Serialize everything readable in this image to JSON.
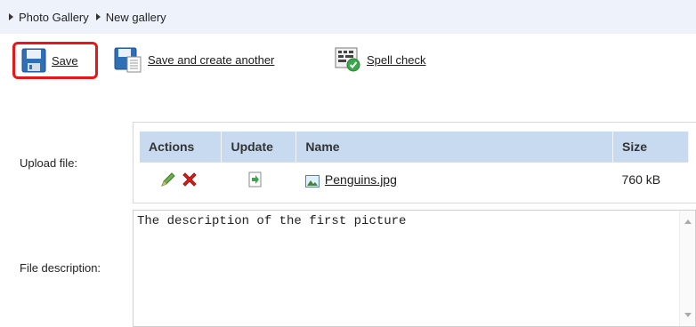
{
  "breadcrumb": {
    "items": [
      "Photo Gallery",
      "New gallery"
    ]
  },
  "toolbar": {
    "save_label": "Save",
    "save_and_create_label": "Save and create another",
    "spell_check_label": "Spell check"
  },
  "form": {
    "upload_label": "Upload file:",
    "description_label": "File description:",
    "description_value": "The description of the first picture"
  },
  "files_table": {
    "headers": [
      "Actions",
      "Update",
      "Name",
      "Size"
    ],
    "rows": [
      {
        "name": "Penguins.jpg",
        "size": "760 kB"
      }
    ]
  },
  "colors": {
    "highlight": "#e8151a",
    "header_bg": "#c8daf0",
    "breadcrumb_bg": "#eef3fb"
  }
}
